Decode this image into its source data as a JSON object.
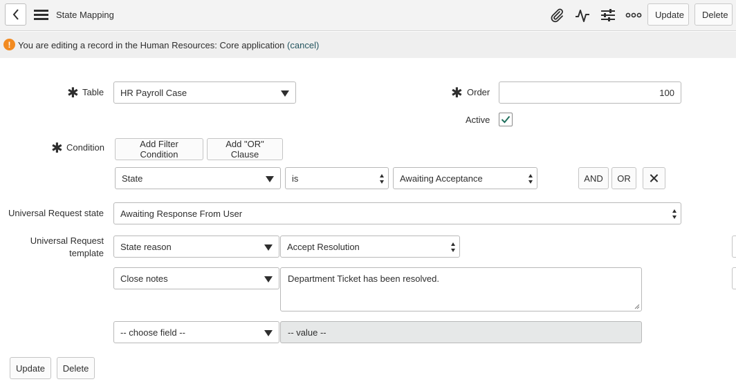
{
  "header": {
    "title": "State Mapping",
    "update_label": "Update",
    "delete_label": "Delete",
    "icons": [
      "back-icon",
      "menu-icon",
      "paperclip-icon",
      "activity-icon",
      "sliders-icon",
      "more-icon"
    ]
  },
  "notice": {
    "text": "You are editing a record in the Human Resources: Core application",
    "link": "(cancel)"
  },
  "form": {
    "table": {
      "label": "Table",
      "value": "HR Payroll Case"
    },
    "order": {
      "label": "Order",
      "value": "100"
    },
    "active": {
      "label": "Active",
      "checked": true
    },
    "condition": {
      "label": "Condition",
      "add_filter_label": "Add Filter Condition",
      "add_or_label": "Add \"OR\" Clause",
      "field": "State",
      "operator": "is",
      "value": "Awaiting Acceptance",
      "and_label": "AND",
      "or_label": "OR"
    },
    "universal_request_state": {
      "label": "Universal Request state",
      "value": "Awaiting Response From User"
    },
    "universal_request_template": {
      "label_line1": "Universal Request",
      "label_line2": "template",
      "rows": [
        {
          "field": "State reason",
          "value": "Accept Resolution"
        },
        {
          "field": "Close notes",
          "value": "Department Ticket has been resolved."
        },
        {
          "field": "-- choose field --",
          "value": "-- value --"
        }
      ]
    }
  },
  "footer": {
    "update_label": "Update",
    "delete_label": "Delete"
  },
  "colors": {
    "accent_check": "#1f6f5c",
    "notice_icon": "#f28a20",
    "link": "#24555f"
  }
}
